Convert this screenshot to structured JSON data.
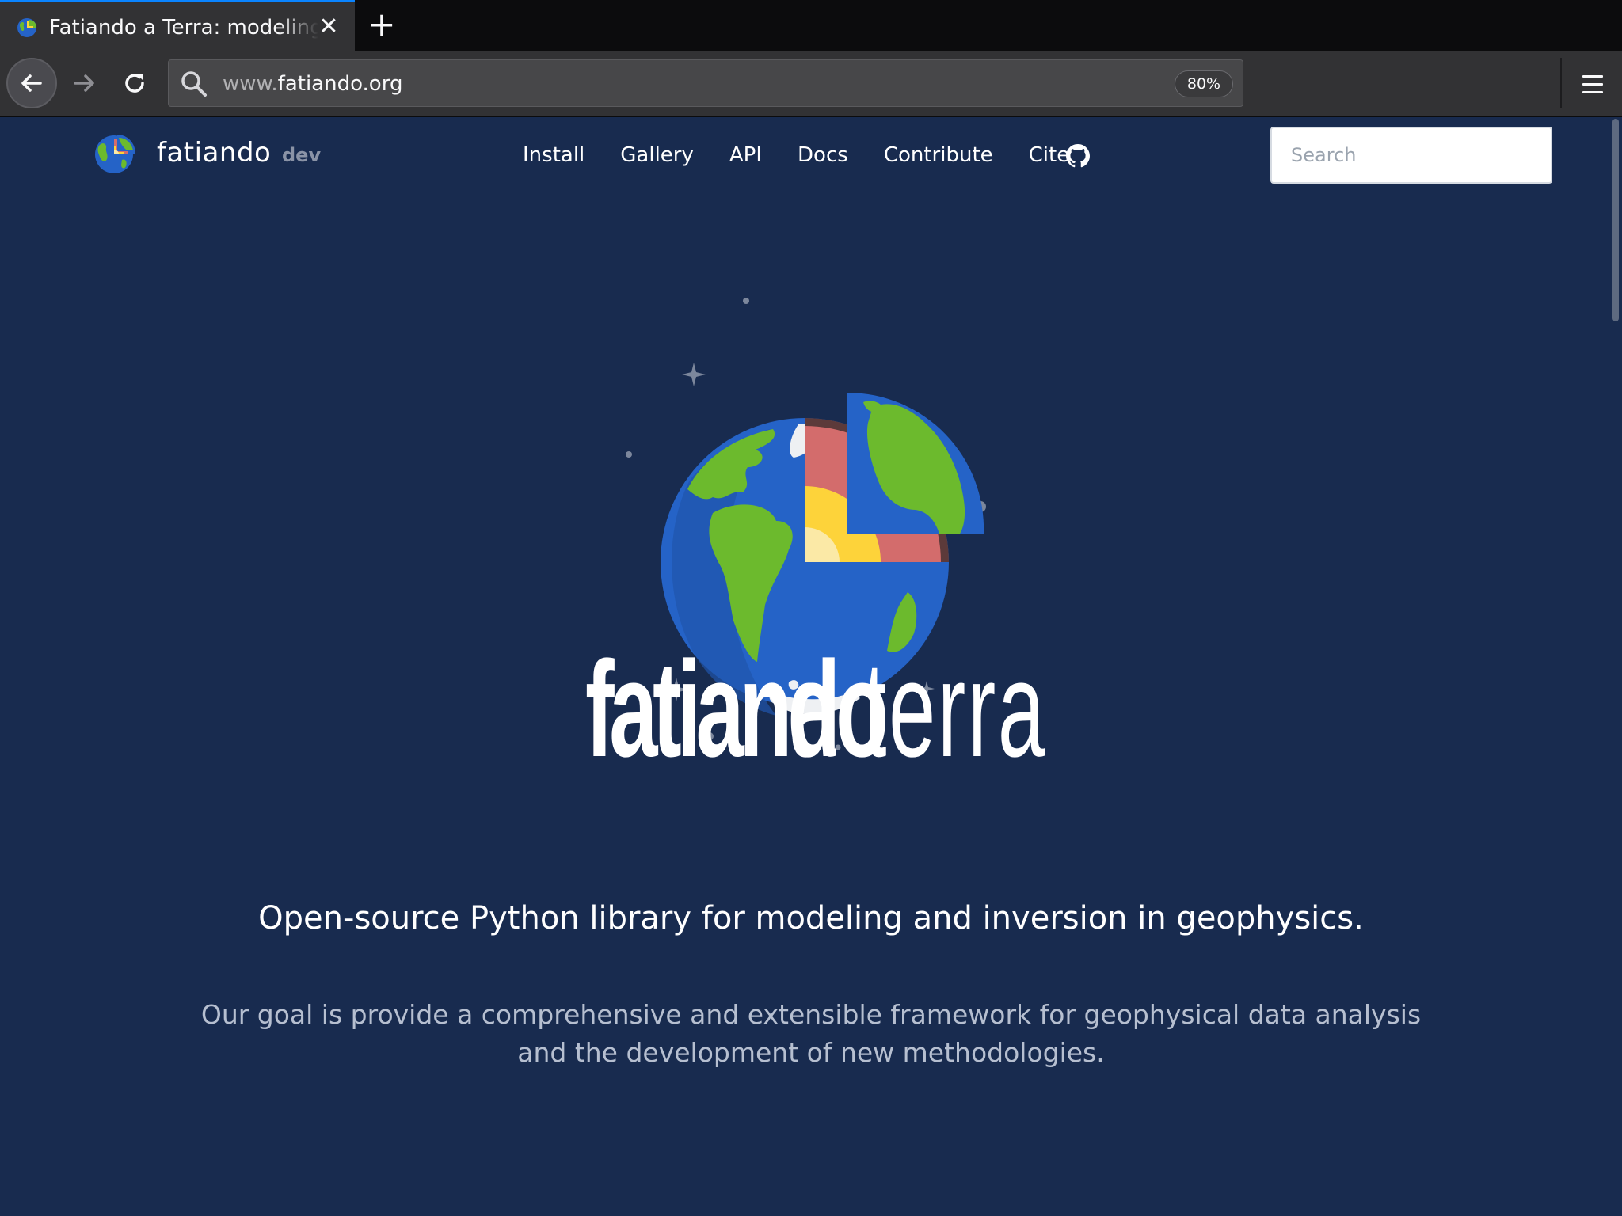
{
  "browser": {
    "tab_title": "Fatiando a Terra: modeling and inversion",
    "tab_close": "✕",
    "new_tab": "+",
    "url_prefix": "www.",
    "url_domain": "fatiando.org",
    "zoom": "80%"
  },
  "nav": {
    "brand": "fatiando",
    "version": "dev",
    "links": [
      "Install",
      "Gallery",
      "API",
      "Docs",
      "Contribute",
      "Cite"
    ],
    "search_placeholder": "Search"
  },
  "hero": {
    "wordmark_bold": "fatiando",
    "wordmark_light": "a terra",
    "tagline": "Open-source Python library for modeling and inversion in geophysics.",
    "goal": "Our goal is provide a comprehensive and extensible framework for geophysical data analysis and the development of new methodologies."
  },
  "colors": {
    "page_background": "#182b4f",
    "ocean": "#2563c7",
    "land": "#6cba2d",
    "crust": "#d36c6c",
    "mantle": "#fdd33a",
    "core": "#fbe9a6",
    "tab_accent": "#0a84ff"
  },
  "icons": {
    "back": "arrow-left-icon",
    "forward": "arrow-right-icon",
    "reload": "reload-icon",
    "url_search": "search-icon",
    "menu": "hamburger-menu-icon",
    "github": "github-icon",
    "logo": "earth-globe-logo"
  }
}
